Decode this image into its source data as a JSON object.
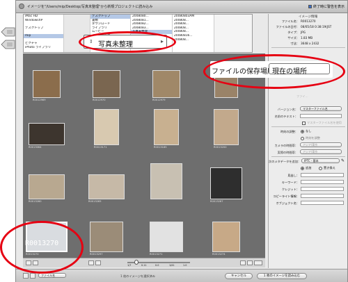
{
  "window": {
    "title": "イメージを\"/Users/mip/Desktop/写真未整理\"から新規プロジェクトに読み込み",
    "close_after_import_label": "終了時に警告を表示"
  },
  "browser": {
    "col1": [
      "iMac HD",
      "WindowsXP",
      "",
      "デスクトップ",
      "",
      "mip",
      "",
      "ピクチャ",
      "iPhoto ライブラリ"
    ],
    "col2": [
      "デスクトップ",
      "書類",
      "ダウンロード",
      "ライブラリ",
      "ムービー",
      "ミュージック",
      "ピクチャ",
      "Public"
    ],
    "col3": [
      "2008080...",
      "2008081...",
      "2008082...",
      "2008083...",
      "写真未整理",
      "",
      ""
    ],
    "col4": [
      "20080803AM",
      "200808...",
      "200808...",
      "200808...",
      "200808...",
      "20080816...",
      "200808..."
    ],
    "popup_label": "写真未整理"
  },
  "callouts": {
    "file_location_label": "ファイルの保存場所：",
    "file_location_value": "現在の場所",
    "selected_filename": "R0013270"
  },
  "thumbnails": [
    {
      "caption": "R0012969",
      "color": "#8b6d4c"
    },
    {
      "caption": "R0012970",
      "color": "#7a6650"
    },
    {
      "caption": "R0012979",
      "color": "#a08868"
    },
    {
      "caption": "",
      "color": "#9a8368"
    },
    {
      "caption": "R0013064",
      "color": "#3d352e"
    },
    {
      "caption": "R0013171",
      "color": "#d8c9b0"
    },
    {
      "caption": "R0013185",
      "color": "#c8b090"
    },
    {
      "caption": "R0013200",
      "color": "#c2a98c"
    },
    {
      "caption": "R0013260",
      "color": "#b8a890"
    },
    {
      "caption": "R0013265",
      "color": "#c6b9a7"
    },
    {
      "caption": "",
      "color": "#c8c0b2"
    },
    {
      "caption": "R0013267",
      "color": "#2e2e2e"
    },
    {
      "caption": "R0013270",
      "color": "#d9dce0"
    },
    {
      "caption": "R0013297",
      "color": "#9b8c78"
    },
    {
      "caption": "R0013271",
      "color": "#e2e2e2"
    },
    {
      "caption": "R0013274",
      "color": "#c7a987"
    }
  ],
  "toolbar_bottom": {
    "zoom_ticks": [
      "1/7",
      "0.11",
      "0.0",
      "1/41",
      "1.0"
    ]
  },
  "footer": {
    "format_label": "ファイル名",
    "status": "1 枚のイメージを選択済み",
    "cancel": "キャンセル",
    "import": "1 枚のイメージを読み込む"
  },
  "panel": {
    "info_header": "イメージ情報",
    "info_rows": [
      {
        "label": "ファイル名：",
        "value": "R0013270"
      },
      {
        "label": "ファイルの日付：",
        "value": "08/05/18 0:38:19(JST"
      },
      {
        "label": "タイプ：",
        "value": "JPG"
      },
      {
        "label": "サイズ：",
        "value": "1.83 MB"
      },
      {
        "label": "寸法：",
        "value": "3648 x 2432"
      }
    ],
    "file_option_faded": "ファイ...",
    "version_label": "バージョン名：",
    "version_value": "マスターファイル名",
    "name_text_label": "名前のテキスト：",
    "master_file_name_check": "マスターファイル名を使用",
    "time_adjust_label": "時刻の調整：",
    "time_adjust_none": "なし",
    "time_adjust_adjust": "時刻を調整",
    "camera_tz_label": "カメラの時間帯：",
    "camera_tz_value": "アジア/東京",
    "actual_tz_label": "実際の時間帯：",
    "actual_tz_value": "アジア/東京",
    "meta_label": "次のメタデータを追加：",
    "meta_value": "IPTC - 基本",
    "meta_append": "追加",
    "meta_replace": "置き換え",
    "meta_fields": [
      "見出し：",
      "キーワード：",
      "クレジット：",
      "コピーライト情報：",
      "オブジェクト名："
    ]
  }
}
